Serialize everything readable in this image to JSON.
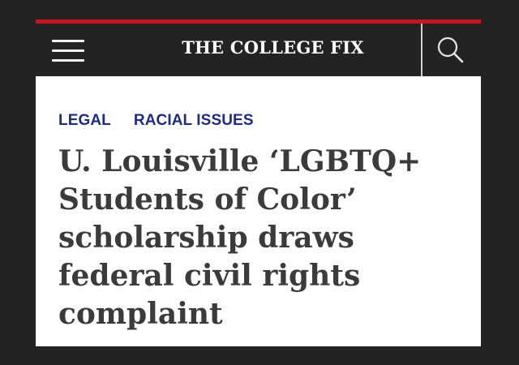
{
  "header": {
    "site_title": "THE COLLEGE FIX",
    "menu_icon": "hamburger-menu-icon",
    "search_icon": "search-icon"
  },
  "article": {
    "categories": [
      {
        "label": "LEGAL"
      },
      {
        "label": "RACIAL ISSUES"
      }
    ],
    "headline_lines": [
      "U. Louisville ‘LGBTQ+",
      "Students of Color’",
      "scholarship draws",
      "federal civil rights",
      "complaint"
    ]
  },
  "colors": {
    "page_background": "#232323",
    "accent_bar": "#c8161d",
    "header_background": "#232323",
    "category_link": "#1e2a86",
    "headline_text": "#3b3b3b"
  }
}
